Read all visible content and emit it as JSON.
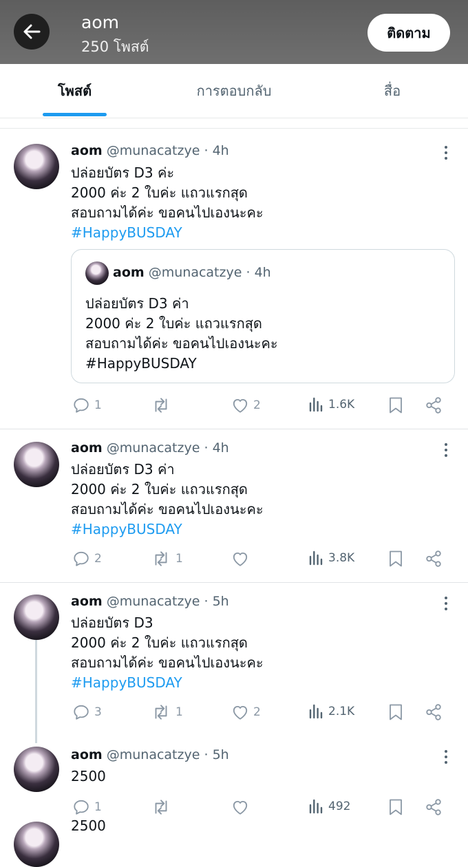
{
  "header": {
    "profile_name": "aom",
    "post_count": "250 โพสต์",
    "follow_label": "ติดตาม"
  },
  "tabs": [
    {
      "label": "โพสต์",
      "active": true
    },
    {
      "label": "การตอบกลับ",
      "active": false
    },
    {
      "label": "สื่อ",
      "active": false
    }
  ],
  "colors": {
    "accent": "#1d9bf0",
    "header_bg": "#666666"
  },
  "tweets": [
    {
      "name": "aom",
      "handle": "@munacatzye",
      "dot": "·",
      "time": "4h",
      "lines": [
        "ปล่อยบัตร D3 ค่ะ",
        "2000 ค่ะ 2 ใบค่ะ แถวแรกสุด",
        "สอบถามได้ค่ะ ขอคนไปเองนะคะ"
      ],
      "hashtag": "#HappyBUSDAY",
      "quote": {
        "name": "aom",
        "handle": "@munacatzye",
        "dot": "·",
        "time": "4h",
        "lines": [
          "ปล่อยบัตร D3 ค่า",
          "2000 ค่ะ 2 ใบค่ะ แถวแรกสุด",
          "สอบถามได้ค่ะ ขอคนไปเองนะคะ",
          "#HappyBUSDAY"
        ]
      },
      "replies": "1",
      "reposts": "",
      "likes": "2",
      "views": "1.6K"
    },
    {
      "name": "aom",
      "handle": "@munacatzye",
      "dot": "·",
      "time": "4h",
      "lines": [
        "ปล่อยบัตร D3 ค่า",
        "2000 ค่ะ 2 ใบค่ะ แถวแรกสุด",
        "สอบถามได้ค่ะ ขอคนไปเองนะคะ"
      ],
      "hashtag": "#HappyBUSDAY",
      "replies": "2",
      "reposts": "1",
      "likes": "",
      "views": "3.8K"
    },
    {
      "name": "aom",
      "handle": "@munacatzye",
      "dot": "·",
      "time": "5h",
      "lines": [
        "ปล่อยบัตร D3",
        "2000 ค่ะ 2 ใบค่ะ แถวแรกสุด",
        "สอบถามได้ค่ะ ขอคนไปเองนะคะ"
      ],
      "hashtag": "#HappyBUSDAY",
      "replies": "3",
      "reposts": "1",
      "likes": "2",
      "views": "2.1K"
    },
    {
      "name": "aom",
      "handle": "@munacatzye",
      "dot": "·",
      "time": "5h",
      "lines": [
        "2500"
      ],
      "replies": "1",
      "reposts": "",
      "likes": "",
      "views": "492"
    }
  ],
  "partial_next_text": "2500",
  "icons": [
    "back-arrow-icon",
    "more-icon",
    "reply-icon",
    "repost-icon",
    "like-icon",
    "views-icon",
    "bookmark-icon",
    "share-icon"
  ]
}
